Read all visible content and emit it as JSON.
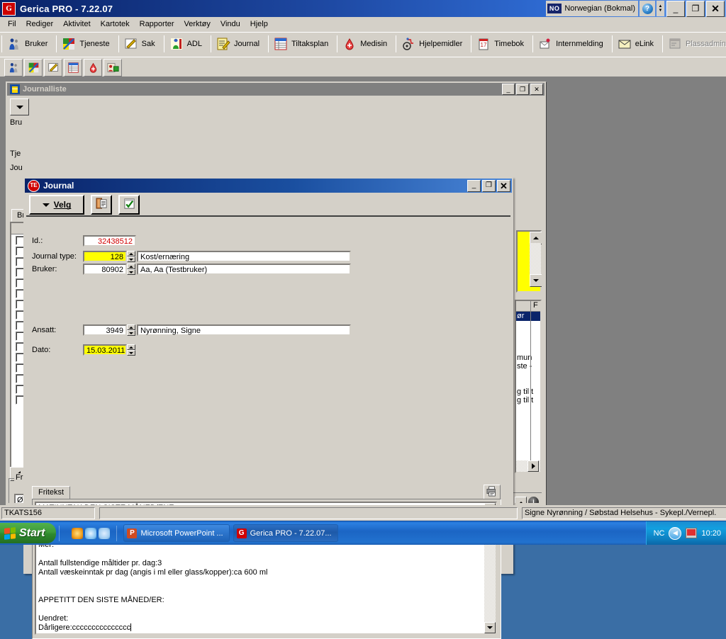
{
  "app": {
    "title": "Gerica PRO - 7.22.07",
    "icon": "gerica-logo-icon",
    "language_code": "NO",
    "language_label": "Norwegian (Bokmal)",
    "help_glyph": "?",
    "minimize_glyph": "_",
    "restore_glyph": "❐",
    "close_glyph": "✕"
  },
  "menu": {
    "items": [
      "Fil",
      "Rediger",
      "Aktivitet",
      "Kartotek",
      "Rapporter",
      "Verktøy",
      "Vindu",
      "Hjelp"
    ]
  },
  "toolbar": {
    "buttons": [
      {
        "label": "Bruker",
        "icon": "people-icon",
        "disabled": false
      },
      {
        "label": "Tjeneste",
        "icon": "puzzle-icon",
        "disabled": false
      },
      {
        "label": "Sak",
        "icon": "pencil-note-icon",
        "disabled": false
      },
      {
        "label": "ADL",
        "icon": "person-chair-icon",
        "disabled": false
      },
      {
        "label": "Journal",
        "icon": "notepad-pencil-icon",
        "disabled": false
      },
      {
        "label": "Tiltaksplan",
        "icon": "table-list-icon",
        "disabled": false
      },
      {
        "label": "Medisin",
        "icon": "blood-drop-icon",
        "disabled": false
      },
      {
        "label": "Hjelpemidler",
        "icon": "wheelchair-icon",
        "disabled": false
      },
      {
        "label": "Timebok",
        "icon": "calendar-icon",
        "disabled": false
      },
      {
        "label": "Internmelding",
        "icon": "envelope-hand-icon",
        "disabled": false
      },
      {
        "label": "eLink",
        "icon": "mail-icon",
        "disabled": false
      },
      {
        "label": "Plassadmin",
        "icon": "window-form-icon",
        "disabled": true
      }
    ]
  },
  "toolbar2": {
    "buttons": [
      {
        "icon": "person-small-icon"
      },
      {
        "icon": "puzzle-small-icon"
      },
      {
        "icon": "pencil-note-small-icon"
      },
      {
        "icon": "table-list-small-icon"
      },
      {
        "icon": "blood-drop-small-icon"
      },
      {
        "icon": "user-card-small-icon"
      }
    ]
  },
  "journalliste_window": {
    "title": "Journalliste",
    "icon": "list-window-icon",
    "minimize_glyph": "_",
    "restore_glyph": "❐",
    "close_glyph": "✕",
    "background_labels": [
      "Bru",
      "Tje",
      "Jou"
    ],
    "background_tab": "Br",
    "background_group_label": "Fri",
    "background_mini_value": "Ø",
    "grid_selected_text": "ør",
    "grid_column_header": "F",
    "grid_rows": [
      "mun",
      "ste - ",
      "g til t",
      "g til t"
    ],
    "list_checkbox_count": 16
  },
  "journal_dialog": {
    "title": "Journal",
    "icon": "journal-red-icon",
    "minimize_glyph": "_",
    "restore_glyph": "❐",
    "close_glyph": "✕",
    "toolbar": {
      "velg_label_prefix": "V",
      "velg_label_underlined": "V",
      "velg_label": "Velg",
      "copy_button_icon": "copy-document-icon",
      "approve_button_icon": "checkmark-document-icon"
    },
    "fields": {
      "id_label": "Id.:",
      "id_value": "32438512",
      "journaltype_label": "Journal type:",
      "journaltype_label_accel": "J",
      "journaltype_code": "128",
      "journaltype_text": "Kost/ernæring",
      "bruker_label": "Bruker:",
      "bruker_label_accel": "B",
      "bruker_code": "80902",
      "bruker_text": "Aa, Aa (Testbruker)",
      "ansatt_label": "Ansatt:",
      "ansatt_label_accel": "A",
      "ansatt_code": "3949",
      "ansatt_text": "Nyrønning, Signe",
      "dato_label": "Dato:",
      "dato_label_accel": "D",
      "dato_value": "15.03.2011"
    },
    "tab_label": "Fritekst",
    "print_button_icon": "print-preview-icon",
    "memo_text": "MATINNTAK DEN SISTE MÅNED/ENE:\n\nUendret:\nMindre:xxxxxxxxxxxxxxxx\nMer:\n\nAntall fullstendige måltider pr. dag:3\nAntall væskeinntak pr dag (angis i ml eller glass/kopper):ca 600 ml\n\n\nAPPETITT DEN SISTE MÅNED/ER:\n\nUendret:\nDårligere:ccccccccccccccc"
  },
  "statusbar": {
    "left": "TKATS156",
    "middle": "",
    "right": "Signe Nyrønning / Søbstad Helsehus - Sykepl./Vernepl."
  },
  "taskbar": {
    "start_label": "Start",
    "quicklaunch": [
      {
        "icon": "media-player-icon",
        "color": "#f0a020"
      },
      {
        "icon": "browser-e-icon",
        "color": "#cfe8ff"
      },
      {
        "icon": "explorer-icon",
        "color": "#bcd9f5"
      }
    ],
    "tasks": [
      {
        "label": "Microsoft PowerPoint ...",
        "icon": "powerpoint-icon",
        "icon_letter": "P",
        "icon_color": "#d04a20",
        "active": false
      },
      {
        "label": "Gerica PRO - 7.22.07...",
        "icon": "gerica-icon",
        "icon_letter": "G",
        "icon_color": "#d00000",
        "active": true
      }
    ],
    "tray": {
      "language": "NC",
      "chevron_icon": "show-hidden-icons-icon",
      "monitor_icon": "display-icon",
      "clock": "10:20"
    }
  },
  "colors": {
    "titlebar_blue": "#0a246a",
    "face": "#d4d0c8",
    "highlight_yellow": "#ffff00",
    "id_red": "#d00000",
    "selection_blue": "#0a246a",
    "desktop": "#3a6ea5"
  }
}
